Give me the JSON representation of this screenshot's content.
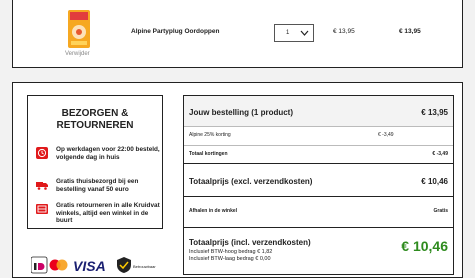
{
  "product": {
    "name": "Alpine Partyplug Oordoppen",
    "remove_label": "Verwijder",
    "quantity": "1",
    "unit_price": "€ 13,95",
    "total": "€ 13,95"
  },
  "delivery": {
    "title": "BEZORGEN & RETOURNEREN",
    "benefits": [
      "Op werkdagen voor 22:00 besteld, volgende dag in huis",
      "Gratis thuisbezorgd bij een bestelling vanaf 50 euro",
      "Gratis retourneren in alle Kruidvat winkels, altijd een winkel in de buurt"
    ]
  },
  "payments": {
    "visa": "VISA",
    "secure": "Betrouwbaar"
  },
  "summary": {
    "order_label": "Jouw bestelling (1 product)",
    "order_total": "€ 13,95",
    "discount_label": "Alpine 25% korting",
    "discount_value": "€ -3,49",
    "total_discount_label": "Totaal kortingen",
    "total_discount_value": "€ -3,49",
    "excl_label": "Totaalprijs (excl. verzendkosten)",
    "excl_value": "€ 10,46",
    "pickup_label": "Afhalen in de winkel",
    "pickup_value": "Gratis",
    "incl_label": "Totaalprijs (incl. verzendkosten)",
    "incl_value": "€ 10,46",
    "vat_high": "Inclusief BTW-hoog bedrag € 1,82",
    "vat_low": "Inclusief BTW-laag bedrag € 0,00"
  },
  "colors": {
    "accent_green": "#2e8b1e",
    "icon_red": "#e0191b"
  }
}
